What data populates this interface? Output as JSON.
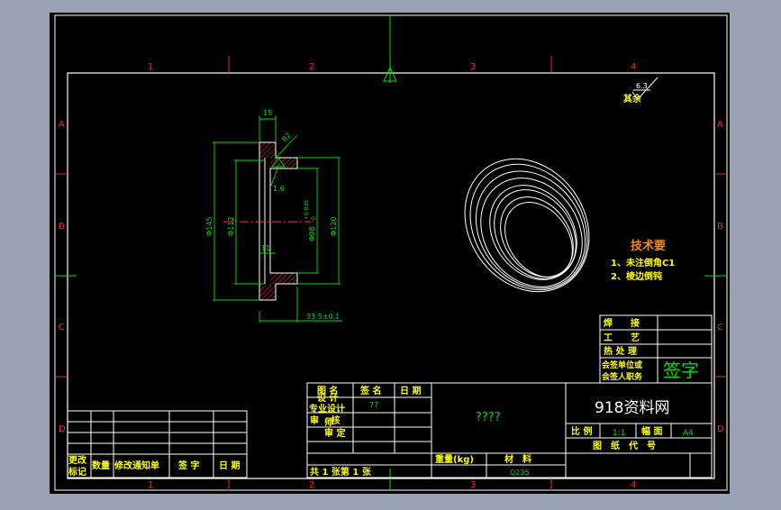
{
  "colors": {
    "background": "#9aa3b6",
    "sheet": "#000000",
    "frame": "#ffffff",
    "border": "#e03030",
    "dimension": "#00e000",
    "text_yellow": "#ffff00",
    "text_white": "#ffffff",
    "text_orange": "#ff8800",
    "hatch": "#cc2222"
  },
  "zone_labels": {
    "columns": [
      "1",
      "2",
      "3",
      "4"
    ],
    "rows": [
      "A",
      "B",
      "C",
      "D"
    ]
  },
  "drawing": {
    "dim_top": "15",
    "dim_radius": "R2",
    "dim_roughness": "1.6",
    "dim_outer": "Φ145",
    "dim_inner": "Φ112",
    "dim_98_prefix": "Φ98",
    "dim_98_tol_upper": "+0.035",
    "dim_98_tol_lower": "0",
    "dim_120": "Φ120",
    "dim_11": "11",
    "dim_length": "33.5±0.1",
    "surface_roughness_value": "6.3",
    "surface_roughness_rest": "其余"
  },
  "tech_requirements": {
    "title": "技术要",
    "item1": "1、未注倒角C1",
    "item2": "2、棱边倒钝"
  },
  "title_block": {
    "signoff_rows": [
      "焊　　接",
      "工　　艺",
      "热 处 理",
      "会签单位或",
      "会签人职务"
    ],
    "signoff_sign": "签字",
    "company": "918资料网",
    "part_name": "????",
    "design_header_col1": "图 名",
    "design_header_col2": "签 名",
    "design_header_col3": "日 期",
    "design_row1_role": "设 计",
    "design_row1_role_overlap": "专业设计",
    "design_row1_sign": "77",
    "design_row2_role": "审 　核",
    "design_row2_role_overlap": "师",
    "design_row3_role": "审 定",
    "sheets_label": "共 1 张第 1 张",
    "weight_label": "重量(kg)",
    "material_label": "材　料",
    "material_value": "Q235",
    "scale_label": "比 例",
    "scale_value": "1:1",
    "size_label": "幅 面",
    "size_value": "A4",
    "drawing_code_label": "图　纸　代　号"
  },
  "revision_block": {
    "col1_line1": "更改",
    "col1_line2": "标记",
    "col2": "数量",
    "col3": "修改通知单",
    "col4": "签 字",
    "col5": "日 期"
  }
}
